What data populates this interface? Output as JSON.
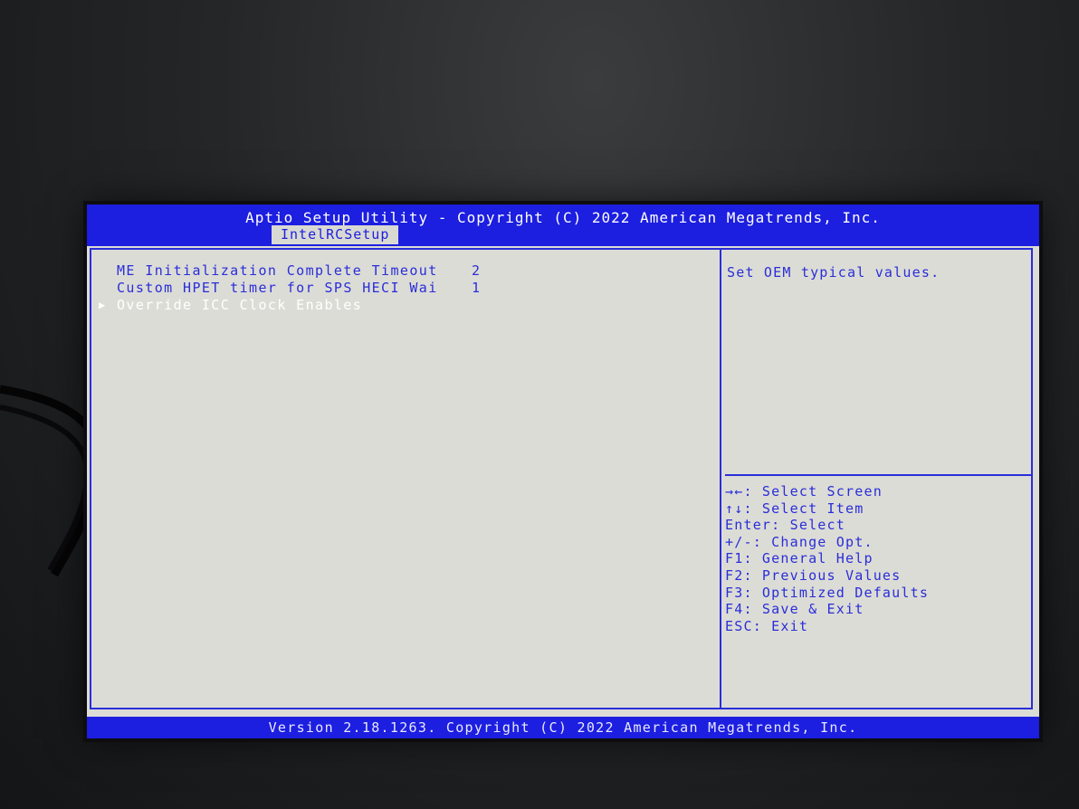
{
  "header": {
    "title": "Aptio Setup Utility - Copyright (C) 2022 American Megatrends, Inc.",
    "tab": "IntelRCSetup"
  },
  "menu": {
    "items": [
      {
        "label": "ME Initialization Complete Timeout",
        "value": "2"
      },
      {
        "label": "Custom HPET timer for SPS HECI Wai",
        "value": "1"
      },
      {
        "label": "Override ICC Clock Enables",
        "value": ""
      }
    ],
    "submenu_marker": "▶"
  },
  "help": {
    "text": "Set OEM typical values.",
    "keys": [
      "→←: Select Screen",
      "↑↓: Select Item",
      "Enter: Select",
      "+/-: Change Opt.",
      "F1: General Help",
      "F2: Previous Values",
      "F3: Optimized Defaults",
      "F4: Save & Exit",
      "ESC: Exit"
    ]
  },
  "footer": {
    "text": "Version 2.18.1263. Copyright (C) 2022 American Megatrends, Inc."
  },
  "colors": {
    "bar": "#1c1ee0",
    "text": "#2a2ed8",
    "background": "#dcdcd6",
    "highlight": "#ffffff"
  }
}
